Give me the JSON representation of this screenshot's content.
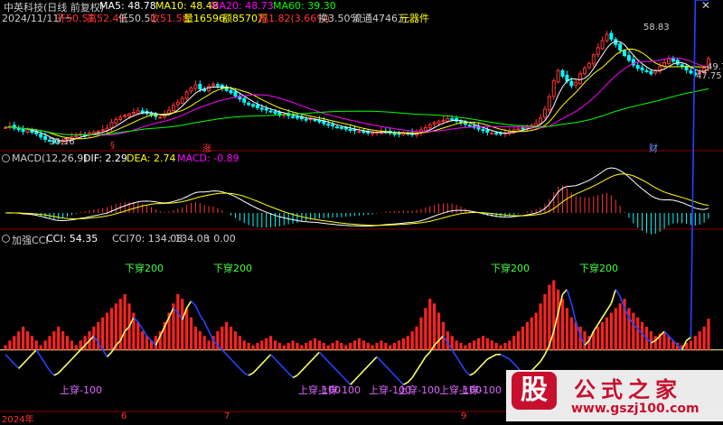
{
  "header": {
    "stock": "中英科技(日线 前复权)",
    "ma5": "MA5: 48.78",
    "ma10": "MA10: 48.48",
    "ma20": "MA20: 48.73",
    "ma60": "MA60: 39.30",
    "quote": {
      "date": "2024/11/11/一",
      "open": "开50.51",
      "high": "高52.49",
      "low": "低50.51",
      "close": "收51.58",
      "volume": "量16596",
      "amount": "额8570万",
      "change": "幅1.82(3.66%)",
      "turnover": "换3.50%",
      "float": "流通4746万",
      "sector": "元器件"
    },
    "colors": {
      "ma5": "#ffffff",
      "ma10": "#ffff00",
      "ma20": "#ff00ff",
      "ma60": "#00ff00",
      "up": "#ff3333",
      "down": "#00ffff"
    }
  },
  "price_panel": {
    "high_label": "58.83",
    "low_label": "30.16",
    "right_labels": [
      "49.78",
      "47.75"
    ],
    "markers": [
      {
        "text": "§",
        "color": "#ff3333"
      },
      {
        "text": "涨",
        "color": "#ff3333"
      },
      {
        "text": "财",
        "color": "#6699ff"
      }
    ]
  },
  "macd_panel": {
    "title": "MACD(12,26,9)",
    "dif": "DIF: 2.29",
    "dea": "DEA: 2.74",
    "macd": "MACD: -0.89"
  },
  "cci_panel": {
    "title": "加强CCI",
    "cci": "CCI: 54.35",
    "cci70": "CCI70: 134.08",
    "v2": ": 134.08",
    "v3": ": 0.00",
    "annotations_down": [
      "下穿200",
      "下穿200",
      "下穿200",
      "下穿200"
    ],
    "annotations_up": [
      "上穿-100",
      "上穿-100",
      "上穿-100",
      "上穿-100",
      "上穿-100",
      "上穿-100",
      "上穿-100"
    ]
  },
  "x_axis": {
    "labels": [
      "2024年",
      "6",
      "7",
      "9"
    ]
  },
  "watermark": {
    "glyph": "股",
    "name": "公式之家",
    "url": "www.gszj100.com"
  },
  "chart_data": [
    {
      "type": "candlestick",
      "title": "中英科技(日线 前复权)",
      "ylim": [
        29,
        61
      ],
      "x": [
        "d0",
        "d1",
        "d2",
        "d3",
        "d4",
        "d5",
        "d6",
        "d7",
        "d8",
        "d9",
        "d10",
        "d11",
        "d12",
        "d13",
        "d14",
        "d15",
        "d16",
        "d17",
        "d18",
        "d19",
        "d20",
        "d21",
        "d22",
        "d23",
        "d24",
        "d25",
        "d26",
        "d27",
        "d28",
        "d29",
        "d30",
        "d31",
        "d32",
        "d33",
        "d34",
        "d35",
        "d36",
        "d37",
        "d38",
        "d39",
        "d40",
        "d41",
        "d42",
        "d43",
        "d44",
        "d45",
        "d46",
        "d47",
        "d48",
        "d49",
        "d50",
        "d51",
        "d52",
        "d53",
        "d54",
        "d55",
        "d56",
        "d57",
        "d58",
        "d59",
        "d60",
        "d61",
        "d62",
        "d63",
        "d64",
        "d65",
        "d66",
        "d67",
        "d68",
        "d69",
        "d70",
        "d71",
        "d72",
        "d73",
        "d74",
        "d75",
        "d76",
        "d77",
        "d78",
        "d79",
        "d80",
        "d81",
        "d82",
        "d83",
        "d84",
        "d85",
        "d86",
        "d87",
        "d88",
        "d89",
        "d90",
        "d91",
        "d92",
        "d93",
        "d94",
        "d95",
        "d96",
        "d97",
        "d98",
        "d99",
        "d100",
        "d101",
        "d102",
        "d103",
        "d104",
        "d105",
        "d106",
        "d107",
        "d108",
        "d109",
        "d110",
        "d111",
        "d112",
        "d113",
        "d114",
        "d115",
        "d116",
        "d117",
        "d118",
        "d119",
        "d120",
        "d121",
        "d122",
        "d123",
        "d124",
        "d125",
        "d126",
        "d127",
        "d128",
        "d129",
        "d130",
        "d131",
        "d132",
        "d133",
        "d134",
        "d135",
        "d136",
        "d137",
        "d138",
        "d139",
        "d140",
        "d141",
        "d142",
        "d143",
        "d144",
        "d145",
        "d146",
        "d147",
        "d148",
        "d149",
        "d150",
        "d151",
        "d152",
        "d153",
        "d154",
        "d155",
        "d156",
        "d157",
        "d158",
        "d159"
      ],
      "close": [
        34.2,
        34.5,
        34.0,
        33.8,
        33.2,
        33.6,
        33.0,
        32.6,
        31.8,
        31.2,
        30.8,
        30.4,
        30.5,
        31.0,
        31.4,
        31.8,
        32.0,
        32.5,
        32.3,
        32.8,
        33.0,
        33.2,
        33.6,
        34.0,
        35.5,
        36.2,
        36.8,
        37.2,
        37.6,
        38.0,
        38.4,
        38.0,
        37.8,
        37.5,
        37.0,
        36.8,
        37.4,
        38.6,
        39.8,
        40.6,
        41.6,
        43.2,
        44.2,
        45.0,
        44.0,
        43.5,
        44.6,
        45.2,
        44.8,
        44.2,
        43.6,
        43.0,
        42.2,
        41.4,
        40.6,
        40.0,
        39.6,
        39.2,
        38.8,
        38.6,
        38.2,
        37.8,
        37.4,
        37.6,
        37.2,
        36.8,
        36.6,
        36.4,
        36.2,
        36.4,
        36.0,
        35.6,
        35.2,
        34.8,
        34.6,
        34.2,
        34.0,
        33.8,
        33.6,
        33.4,
        33.2,
        33.0,
        32.8,
        32.8,
        33.0,
        33.2,
        33.0,
        32.8,
        32.6,
        32.6,
        32.8,
        32.6,
        32.4,
        32.8,
        33.6,
        34.2,
        34.8,
        35.4,
        35.8,
        36.0,
        36.4,
        36.2,
        35.8,
        35.4,
        35.0,
        34.6,
        34.2,
        33.8,
        33.4,
        33.0,
        32.8,
        32.6,
        32.6,
        32.8,
        33.2,
        33.6,
        33.8,
        34.0,
        34.4,
        34.8,
        35.2,
        36.6,
        38.8,
        42.0,
        46.0,
        48.6,
        47.2,
        46.0,
        44.8,
        45.6,
        47.8,
        49.2,
        50.4,
        52.6,
        54.4,
        56.2,
        57.8,
        56.6,
        55.2,
        53.8,
        52.4,
        51.2,
        50.0,
        49.2,
        48.8,
        48.4,
        47.8,
        48.6,
        49.6,
        50.6,
        51.6,
        51.0,
        50.2,
        49.6,
        48.8,
        48.0,
        47.6,
        48.4,
        49.2,
        51.6
      ],
      "series_ma": [
        {
          "name": "MA5",
          "color": "#ffffff"
        },
        {
          "name": "MA10",
          "color": "#ffff00"
        },
        {
          "name": "MA20",
          "color": "#ff00ff"
        },
        {
          "name": "MA60",
          "color": "#00ff00"
        }
      ]
    },
    {
      "type": "bar",
      "title": "MACD(12,26,9)",
      "series": [
        {
          "name": "DIF",
          "values": "DIF"
        },
        {
          "name": "DEA",
          "values": "DEA"
        },
        {
          "name": "MACD",
          "values": "MACD"
        }
      ]
    },
    {
      "type": "line",
      "title": "加强CCI",
      "ylim": [
        -250,
        450
      ],
      "cci": [
        -20,
        -40,
        -60,
        -80,
        -60,
        -40,
        -20,
        0,
        -30,
        -60,
        -90,
        -110,
        -100,
        -80,
        -60,
        -40,
        -20,
        0,
        20,
        40,
        60,
        30,
        0,
        -30,
        -10,
        20,
        40,
        80,
        100,
        140,
        120,
        90,
        60,
        40,
        20,
        60,
        100,
        140,
        180,
        160,
        130,
        180,
        210,
        190,
        150,
        120,
        80,
        40,
        20,
        0,
        -20,
        -40,
        -60,
        -80,
        -100,
        -110,
        -100,
        -80,
        -60,
        -40,
        -20,
        -40,
        -60,
        -80,
        -100,
        -120,
        -110,
        -90,
        -70,
        -50,
        -30,
        -10,
        -30,
        -50,
        -70,
        -90,
        -110,
        -130,
        -150,
        -130,
        -110,
        -90,
        -70,
        -50,
        -30,
        -50,
        -70,
        -90,
        -110,
        -130,
        -150,
        -140,
        -120,
        -90,
        -60,
        -30,
        -10,
        20,
        40,
        60,
        30,
        0,
        -30,
        -60,
        -90,
        -110,
        -100,
        -80,
        -60,
        -40,
        -30,
        -20,
        -20,
        -30,
        -40,
        -60,
        -80,
        -100,
        -110,
        -90,
        -70,
        -50,
        -20,
        20,
        80,
        160,
        240,
        260,
        200,
        120,
        60,
        20,
        40,
        80,
        110,
        140,
        170,
        200,
        260,
        230,
        180,
        140,
        110,
        90,
        70,
        50,
        30,
        40,
        60,
        80,
        60,
        40,
        20,
        0,
        40,
        54.35
      ],
      "cci70": [
        20,
        40,
        60,
        80,
        100,
        80,
        60,
        40,
        20,
        40,
        60,
        80,
        100,
        80,
        60,
        40,
        20,
        40,
        60,
        80,
        100,
        120,
        140,
        160,
        180,
        200,
        220,
        240,
        200,
        160,
        120,
        80,
        60,
        40,
        60,
        80,
        120,
        160,
        200,
        240,
        220,
        180,
        140,
        100,
        80,
        60,
        40,
        60,
        80,
        100,
        120,
        100,
        80,
        60,
        40,
        30,
        20,
        30,
        40,
        50,
        60,
        40,
        30,
        20,
        30,
        40,
        30,
        20,
        30,
        40,
        50,
        40,
        30,
        20,
        30,
        40,
        30,
        20,
        30,
        40,
        50,
        40,
        30,
        20,
        30,
        40,
        30,
        20,
        30,
        40,
        50,
        60,
        80,
        100,
        140,
        180,
        220,
        200,
        160,
        120,
        80,
        60,
        40,
        30,
        20,
        30,
        40,
        50,
        60,
        50,
        40,
        30,
        20,
        30,
        40,
        60,
        80,
        100,
        120,
        140,
        160,
        200,
        240,
        280,
        300,
        260,
        220,
        180,
        140,
        120,
        100,
        80,
        60,
        80,
        100,
        120,
        140,
        160,
        180,
        200,
        220,
        180,
        160,
        140,
        120,
        100,
        80,
        60,
        70,
        80,
        60,
        40,
        30,
        20,
        30,
        40,
        60,
        80,
        100,
        134.08
      ]
    }
  ]
}
